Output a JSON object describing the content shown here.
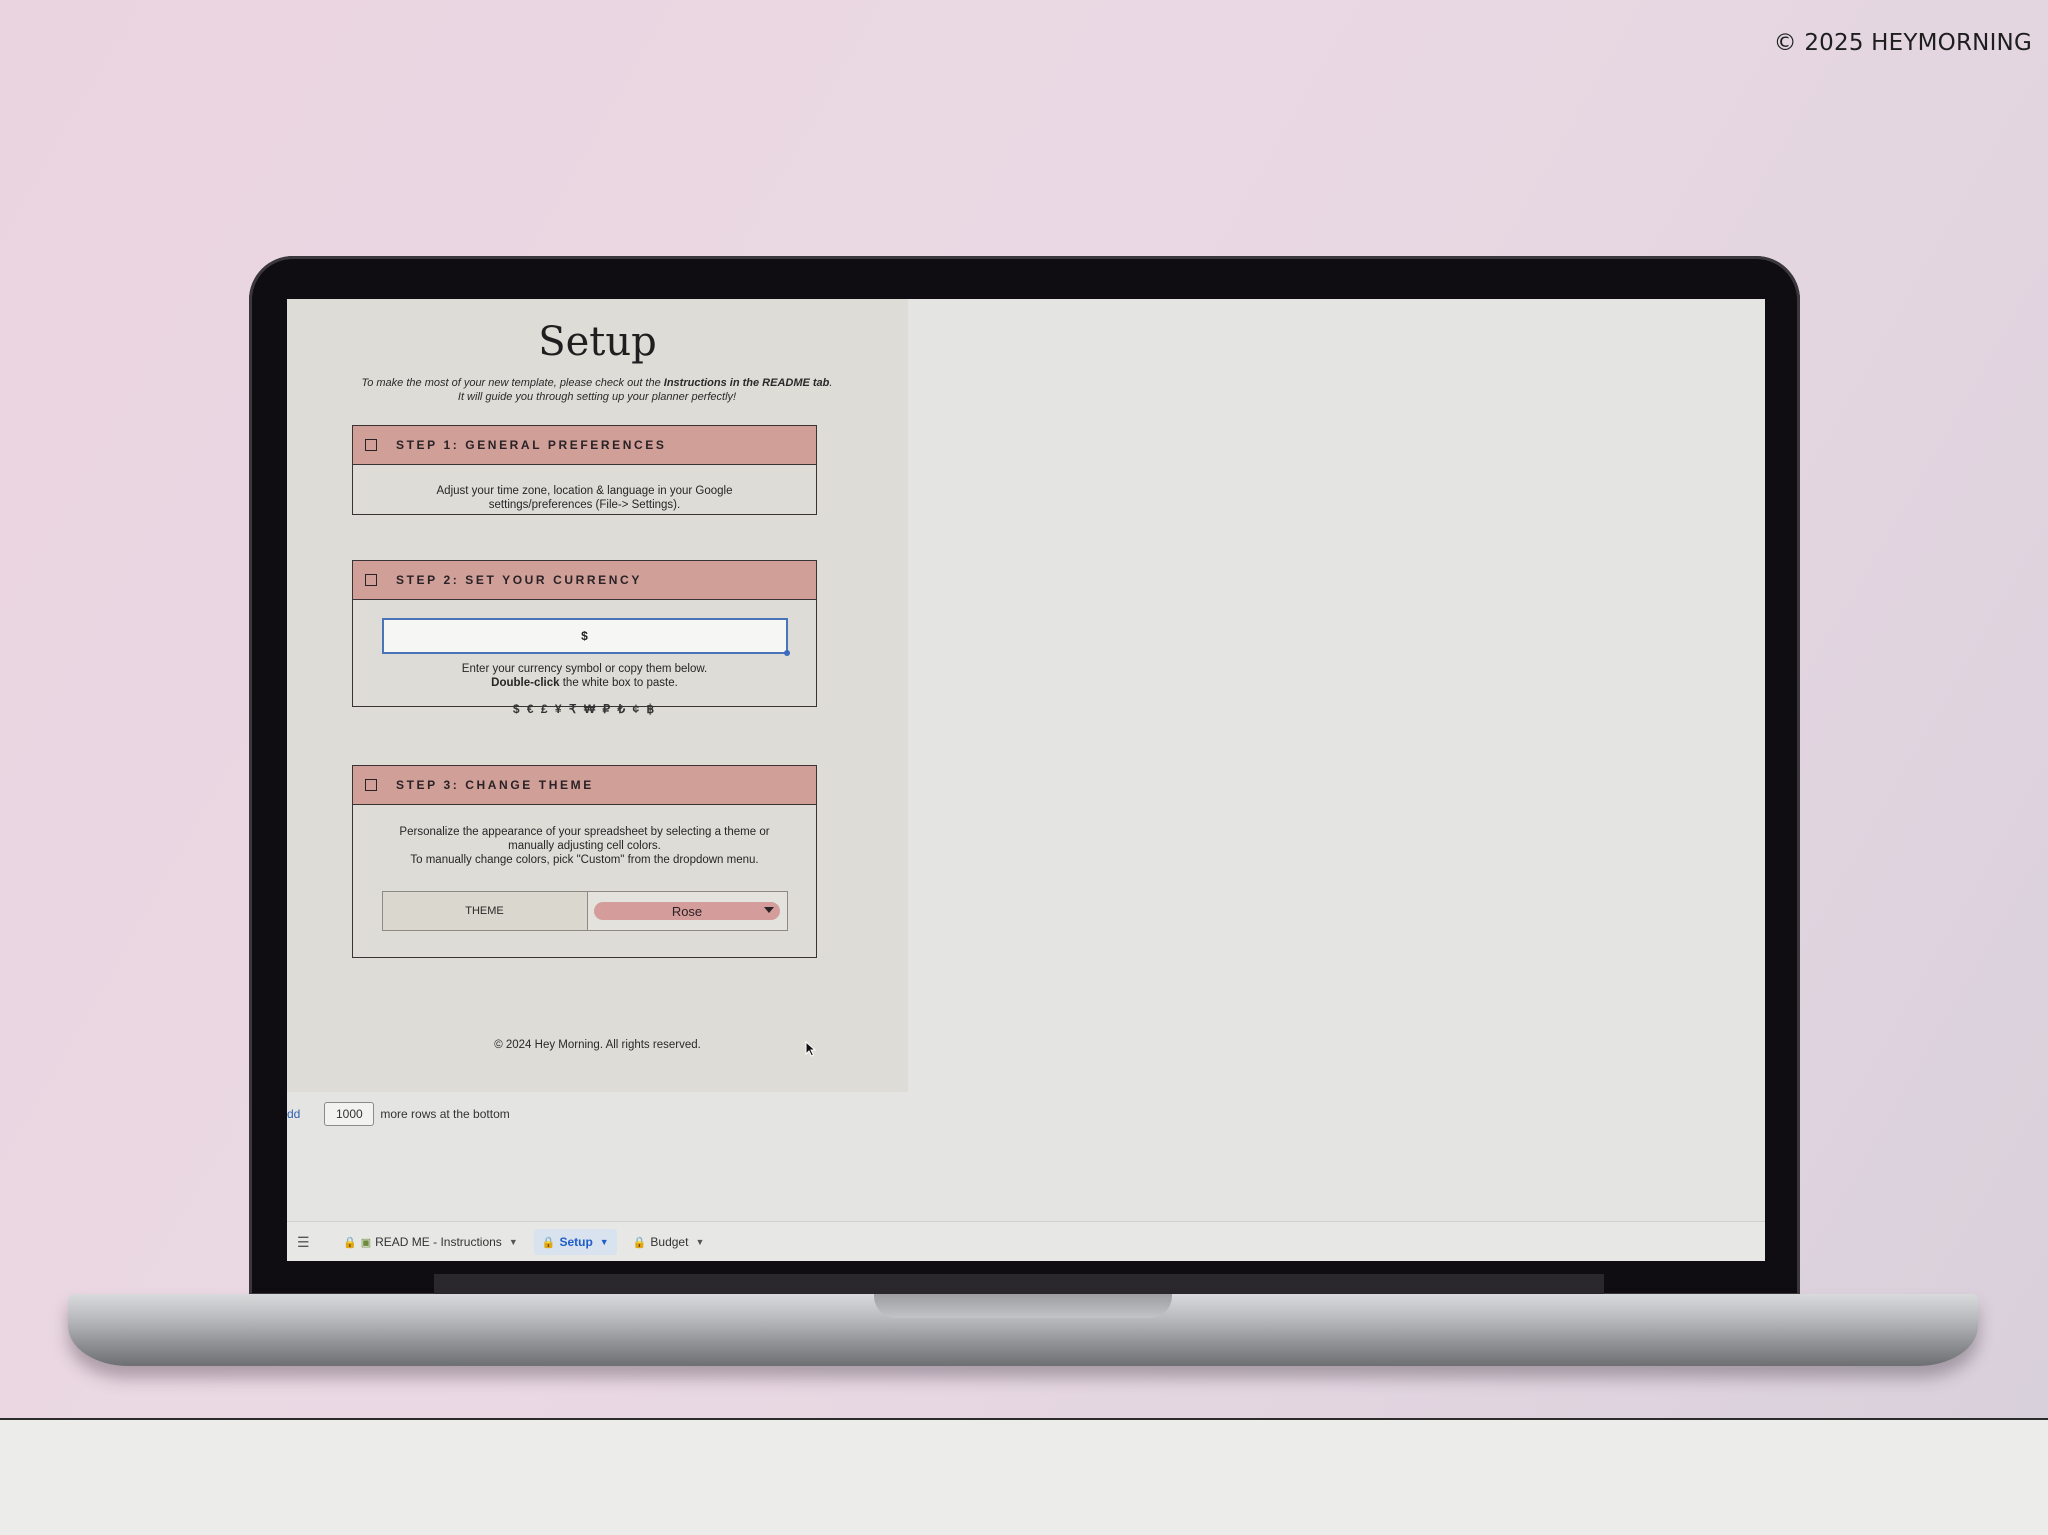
{
  "watermark": "© 2025 HEYMORNING",
  "sheet": {
    "title": "Setup",
    "intro_plain_1": "To make the most of your new template, please check out the ",
    "intro_bold_1": "Instructions in the README tab",
    "intro_plain_2": ". It will guide you through setting up your planner perfectly!",
    "steps": [
      {
        "label": "STEP 1: GENERAL PREFERENCES",
        "text": "Adjust your time zone, location & language in your Google settings/preferences (File-> Settings)."
      },
      {
        "label": "STEP 2: SET YOUR CURRENCY",
        "currency_value": "$",
        "line1": "Enter your currency symbol or copy them below.",
        "line2_bold": "Double-click",
        "line2_rest": " the white box to paste.",
        "symbols": "$ € £ ¥ ₹ ₩ ₽ ₺ ¢ ฿"
      },
      {
        "label": "STEP 3: CHANGE THEME",
        "line1": "Personalize the appearance of your spreadsheet by selecting a theme or manually adjusting cell colors.",
        "line2": "To manually change colors, pick \"Custom\" from the dropdown menu.",
        "theme_label": "THEME",
        "theme_value": "Rose"
      }
    ],
    "footer": "© 2024 Hey Morning. All rights reserved."
  },
  "add_rows": {
    "link": "dd",
    "count": "1000",
    "suffix": "more rows at the bottom"
  },
  "tabs": [
    {
      "label": "READ ME - Instructions",
      "active": false
    },
    {
      "label": "Setup",
      "active": true
    },
    {
      "label": "Budget",
      "active": false
    }
  ],
  "colors": {
    "step_header": "#cf9f98",
    "theme_chip": "#d49c9b",
    "active_tab": "#1f5ec8"
  }
}
